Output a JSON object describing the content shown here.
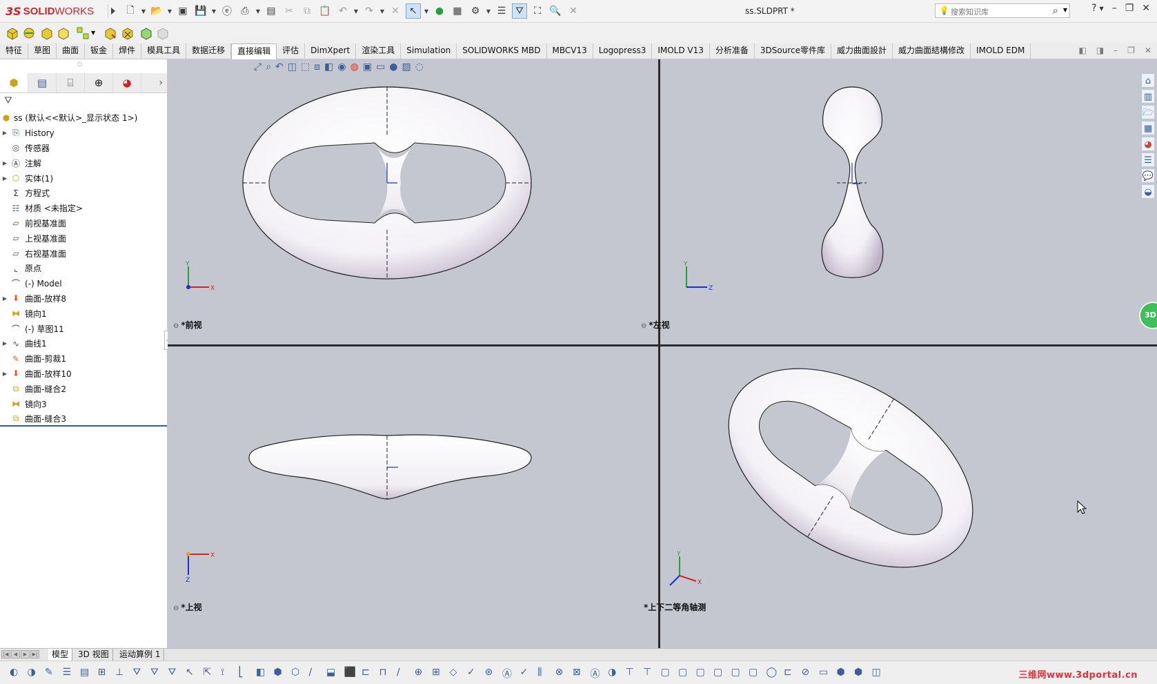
{
  "app": {
    "brand_prefix": "3S",
    "brand_bold": "SOLID",
    "brand_light": "WORKS",
    "document_title": "ss.SLDPRT *",
    "search_placeholder": "搜索知识库"
  },
  "command_tabs": [
    "特征",
    "草图",
    "曲面",
    "钣金",
    "焊件",
    "模具工具",
    "数据迁移",
    "直接编辑",
    "评估",
    "DimXpert",
    "渲染工具",
    "Simulation",
    "SOLIDWORKS MBD",
    "MBCV13",
    "Logopress3",
    "IMOLD V13",
    "分析准备",
    "3DSource零件库",
    "威力曲面設計",
    "威力曲面結構修改",
    "IMOLD EDM"
  ],
  "active_command_tab": "直接编辑",
  "feature_tree": {
    "root": "ss  (默认<<默认>_显示状态 1>)",
    "items": [
      {
        "label": "History",
        "expandable": true,
        "icon": "history-icon"
      },
      {
        "label": "传感器",
        "expandable": false,
        "icon": "sensor-icon"
      },
      {
        "label": "注解",
        "expandable": true,
        "icon": "annotation-icon"
      },
      {
        "label": "实体(1)",
        "expandable": true,
        "icon": "solid-body-icon"
      },
      {
        "label": "方程式",
        "expandable": false,
        "icon": "equation-icon"
      },
      {
        "label": "材质 <未指定>",
        "expandable": false,
        "icon": "material-icon"
      },
      {
        "label": "前视基准面",
        "expandable": false,
        "icon": "plane-icon"
      },
      {
        "label": "上视基准面",
        "expandable": false,
        "icon": "plane-icon"
      },
      {
        "label": "右视基准面",
        "expandable": false,
        "icon": "plane-icon"
      },
      {
        "label": "原点",
        "expandable": false,
        "icon": "origin-icon"
      },
      {
        "label": "(-) Model",
        "expandable": false,
        "icon": "sketch-icon"
      },
      {
        "label": "曲面-放样8",
        "expandable": true,
        "icon": "loft-surface-icon"
      },
      {
        "label": "镜向1",
        "expandable": false,
        "icon": "mirror-icon"
      },
      {
        "label": "(-) 草图11",
        "expandable": false,
        "icon": "sketch-icon"
      },
      {
        "label": "曲线1",
        "expandable": true,
        "icon": "curve-icon"
      },
      {
        "label": "曲面-剪裁1",
        "expandable": false,
        "icon": "trim-surface-icon"
      },
      {
        "label": "曲面-放样10",
        "expandable": true,
        "icon": "loft-surface-icon"
      },
      {
        "label": "曲面-缝合2",
        "expandable": false,
        "icon": "knit-surface-icon"
      },
      {
        "label": "镜向3",
        "expandable": false,
        "icon": "mirror-icon"
      },
      {
        "label": "曲面-缝合3",
        "expandable": false,
        "icon": "knit-surface-icon"
      }
    ]
  },
  "viewports": {
    "front": "*前视",
    "left": "*左视",
    "top": "*上视",
    "iso": "*上下二等角轴测"
  },
  "axes": {
    "x": "X",
    "y": "Y",
    "z": "Z"
  },
  "sheet_tabs": [
    "模型",
    "3D 视图",
    "运动算例 1"
  ],
  "active_sheet_tab": "模型",
  "badge_3d": "3D",
  "watermark": "三维网www.3dportal.cn",
  "colors": {
    "viewport_bg": "#c4c7cf",
    "accent_red": "#d2232a",
    "active_tab_line": "#2a5db0"
  }
}
